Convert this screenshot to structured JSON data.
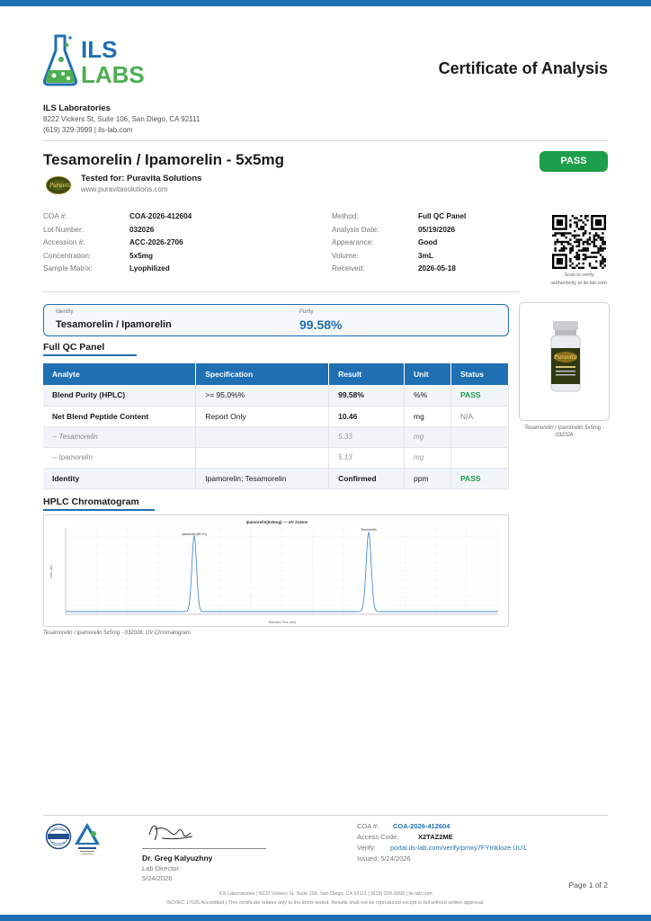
{
  "header": {
    "logo_text_1": "ILS",
    "logo_text_2": "LABS",
    "doc_title": "Certificate of Analysis"
  },
  "lab": {
    "name": "ILS Laboratories",
    "address": "8222 Vickers St, Suite 106, San Diego, CA 92111",
    "contact": "(619) 329-3999  |  ils-lab.com"
  },
  "product": {
    "title": "Tesamorelin / Ipamorelin - 5x5mg",
    "status": "PASS",
    "tested_for": "Tested for: Puravita Solutions",
    "client_url": "www.puravitasolutions.com",
    "client_logo_text": "Puravita"
  },
  "meta_left": [
    {
      "k": "COA #:",
      "v": "COA-2026-412604"
    },
    {
      "k": "Lot Number:",
      "v": "032026"
    },
    {
      "k": "Accession #:",
      "v": "ACC-2026-2706"
    },
    {
      "k": "Concentration:",
      "v": "5x5mg"
    },
    {
      "k": "Sample Matrix:",
      "v": "Lyophilized"
    }
  ],
  "meta_right": [
    {
      "k": "Method:",
      "v": "Full QC Panel"
    },
    {
      "k": "Analysis Date:",
      "v": "05/19/2026"
    },
    {
      "k": "Appearance:",
      "v": "Good"
    },
    {
      "k": "Volume:",
      "v": "3mL"
    },
    {
      "k": "Received:",
      "v": "2026-05-18"
    }
  ],
  "qr": {
    "caption_1": "Scan to verify",
    "caption_2": "authenticity at ils-lab.com"
  },
  "summary": {
    "identity_label": "Identity",
    "identity_value": "Tesamorelin / Ipamorelin",
    "purity_label": "Purity",
    "purity_value": "99.58%"
  },
  "vial": {
    "label_text": "Puravita",
    "caption": "Tesamorelin / Ipamorelin 5x5mg - 032026"
  },
  "qc_panel": {
    "title": "Full QC Panel",
    "headers": [
      "Analyte",
      "Specification",
      "Result",
      "Unit",
      "Status"
    ],
    "rows": [
      [
        "Blend Purity (HPLC)",
        ">= 95.0%%",
        "99.58%",
        "%%",
        "PASS"
      ],
      [
        "Net Blend Peptide Content",
        "Report Only",
        "10.46",
        "mg",
        "N/A"
      ],
      [
        "-- Tesamorelin",
        "",
        "5.33",
        "mg",
        ""
      ],
      [
        "-- Ipamorelin",
        "",
        "5.13",
        "mg",
        ""
      ],
      [
        "Identity",
        "Ipamorelin; Tesamorelin",
        "Confirmed",
        "ppm",
        "PASS"
      ]
    ]
  },
  "hplc": {
    "title": "HPLC Chromatogram",
    "chart_title": "Ipamorelin(5x5mg) — UV 214nm",
    "caption": "Tesamorelin / Ipamorelin 5x5mg - 032026: UV Chromatogram",
    "peak1_label": "Ipamorelin (85.1%)",
    "peak2_label": "Tesamorelin",
    "xlabel": "Retention Time (min)",
    "ylabel": "mAU (AU)"
  },
  "colors": {
    "accent": "#1f6fb2",
    "pass": "#1e9e4a"
  },
  "signature": {
    "name": "Dr. Greg Kalyuzhny",
    "role": "Lab Director",
    "date": "5/24/2026"
  },
  "verify": {
    "coa_label": "COA #:",
    "coa_value": "COA-2026-412604",
    "access_label": "Access Code:",
    "access_value": "X2TAZ2ME",
    "verify_label": "Verify:",
    "verify_link": "portal.ils-lab.com/verify/pmxy7FYmkloze UU1",
    "issued": "Issued: 5/24/2026"
  },
  "footer": {
    "page": "Page 1 of 2",
    "address_line": "ILS Laboratories  |  8222 Vickers St, Suite 106, San Diego, CA 92111  |  (619) 329-3999  |  ils-lab.com",
    "iso_line": "ISO/IEC 17025 Accredited  |  This certificate relates only to the items tested. Results shall not be reproduced except in full without written approval."
  }
}
